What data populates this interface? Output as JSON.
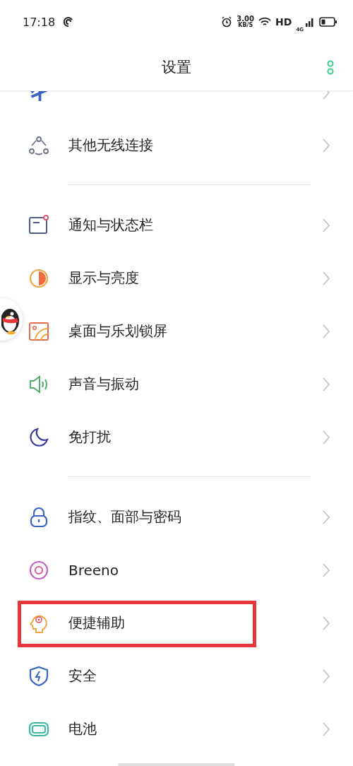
{
  "status_bar": {
    "time": "17:18",
    "speed": "3.00",
    "speed_unit": "KB/S",
    "hd": "HD",
    "network": "4G"
  },
  "header": {
    "title": "设置"
  },
  "sections": [
    {
      "items": [
        {
          "kind": "cut"
        },
        {
          "kind": "row",
          "label": "其他无线连接",
          "highlighted": false
        }
      ]
    },
    {
      "items": [
        {
          "kind": "row",
          "label": "通知与状态栏",
          "highlighted": false
        },
        {
          "kind": "row",
          "label": "显示与亮度",
          "highlighted": false
        },
        {
          "kind": "row",
          "label": "桌面与乐划锁屏",
          "highlighted": false
        },
        {
          "kind": "row",
          "label": "声音与振动",
          "highlighted": false
        },
        {
          "kind": "row",
          "label": "免打扰",
          "highlighted": false
        }
      ]
    },
    {
      "items": [
        {
          "kind": "row",
          "label": "指纹、面部与密码",
          "highlighted": false
        },
        {
          "kind": "row",
          "label": "Breeno",
          "highlighted": false
        },
        {
          "kind": "row",
          "label": "便捷辅助",
          "highlighted": true
        },
        {
          "kind": "row",
          "label": "安全",
          "highlighted": false
        },
        {
          "kind": "row",
          "label": "电池",
          "highlighted": false
        }
      ]
    }
  ]
}
